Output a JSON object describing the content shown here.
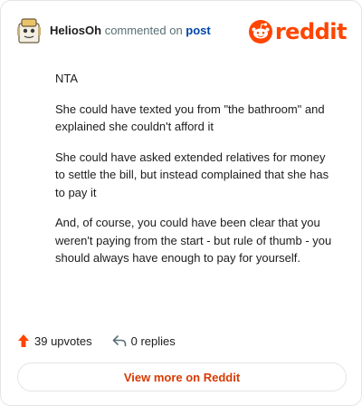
{
  "header": {
    "username": "HeliosOh",
    "action_text": " commented on ",
    "target_text": "post",
    "brand_wordmark": "reddit",
    "brand_color": "#ff4500"
  },
  "comment": {
    "paragraphs": [
      "NTA",
      "She could have texted you from \"the bathroom\" and explained she couldn't afford it",
      "She could have asked extended relatives for money to settle the bill, but instead complained that she has to pay it",
      "And, of course, you could have been clear that you weren't paying from the start - but rule of thumb - you should always have enough to pay for yourself."
    ]
  },
  "stats": {
    "upvotes_label": "39 upvotes",
    "replies_label": "0 replies",
    "upvote_icon": "upvote-arrow-icon",
    "reply_icon": "reply-arrow-icon",
    "upvote_color": "#ff4500"
  },
  "cta": {
    "label": "View more on Reddit",
    "color": "#d93a00"
  },
  "icons": {
    "avatar": "user-avatar-icon",
    "brand": "reddit-snoo-icon"
  }
}
